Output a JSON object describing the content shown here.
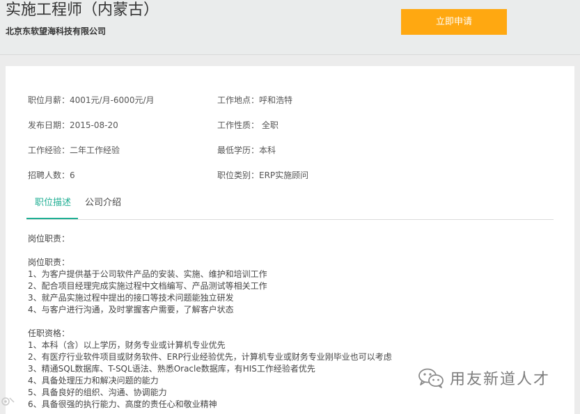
{
  "header": {
    "title": "实施工程师（内蒙古）",
    "company": "北京东软望海科技有限公司",
    "apply_label": "立即申请"
  },
  "info": {
    "salary": "职位月薪：4001元/月-6000元/月",
    "location": "工作地点：呼和浩特",
    "date": "发布日期：2015-08-20",
    "type": "工作性质： 全职",
    "experience": "工作经验：二年工作经验",
    "education": "最低学历：本科",
    "headcount": "招聘人数：6",
    "category": "职位类别：ERP实施顾问"
  },
  "tabs": [
    {
      "label": "职位描述",
      "active": true
    },
    {
      "label": "公司介绍",
      "active": false
    }
  ],
  "description": {
    "heading": "岗位职责：",
    "duties_title": "岗位职责：",
    "duties": [
      "1、为客户提供基于公司软件产品的安装、实施、维护和培训工作",
      "2、配合项目经理完成实施过程中文档编写、产品测试等相关工作",
      "3、就产品实施过程中提出的接口等技术问题能独立研发",
      "4、与客户进行沟通，及时掌握客户需要，了解客户状态"
    ],
    "req_title": "任职资格：",
    "requirements": [
      "1、本科（含）以上学历，财务专业或计算机专业优先",
      "2、有医疗行业软件项目或财务软件、ERP行业经验优先，计算机专业或财务专业刚毕业也可以考虑",
      "3、精通SQL数据库、T-SQL语法、熟悉Oracle数据库，有HIS工作经验者优先",
      "4、具备处理压力和解决问题的能力",
      "5、具备良好的组织、沟通、协调能力",
      "6、具备很强的执行能力、高度的责任心和敬业精神"
    ]
  },
  "watermark": {
    "text": "用友新道人才",
    "icon": "wechat-icon"
  },
  "colors": {
    "accent": "#1fae93",
    "button": "#ffa811"
  }
}
